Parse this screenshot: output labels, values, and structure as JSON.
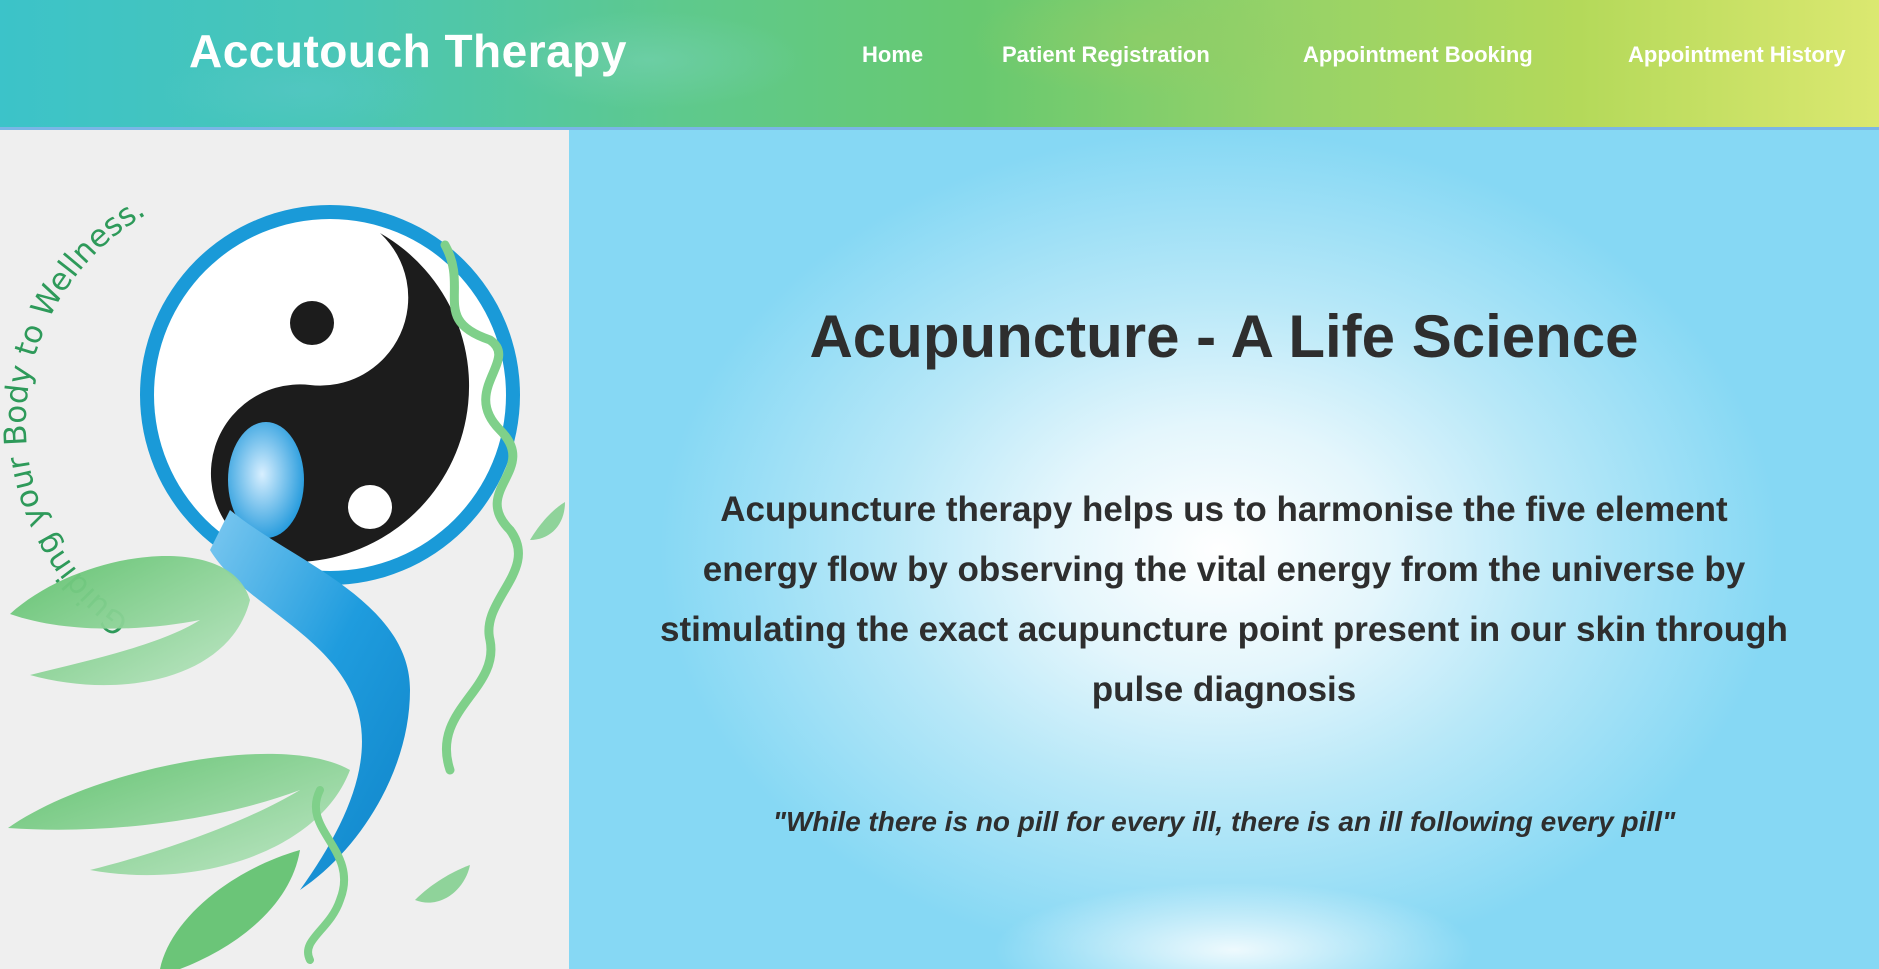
{
  "header": {
    "site_title": "Accutouch Therapy",
    "nav": [
      {
        "label": "Home"
      },
      {
        "label": "Patient Registration"
      },
      {
        "label": "Appointment Booking"
      },
      {
        "label": "Appointment History"
      }
    ]
  },
  "logo": {
    "tagline": "Guiding your Body to Wellness."
  },
  "hero": {
    "title": "Acupuncture - A Life Science",
    "text": "Acupuncture therapy helps us to harmonise the five element energy flow by observing the vital energy from the universe by stimulating the exact acupuncture point present in our skin through pulse diagnosis",
    "quote": "\"While there is no pill for every ill, there is an ill following every pill\""
  },
  "colors": {
    "text_dark": "#2e2e2e",
    "logo_green": "#2e9a5a",
    "logo_blue": "#1a9ad8"
  }
}
